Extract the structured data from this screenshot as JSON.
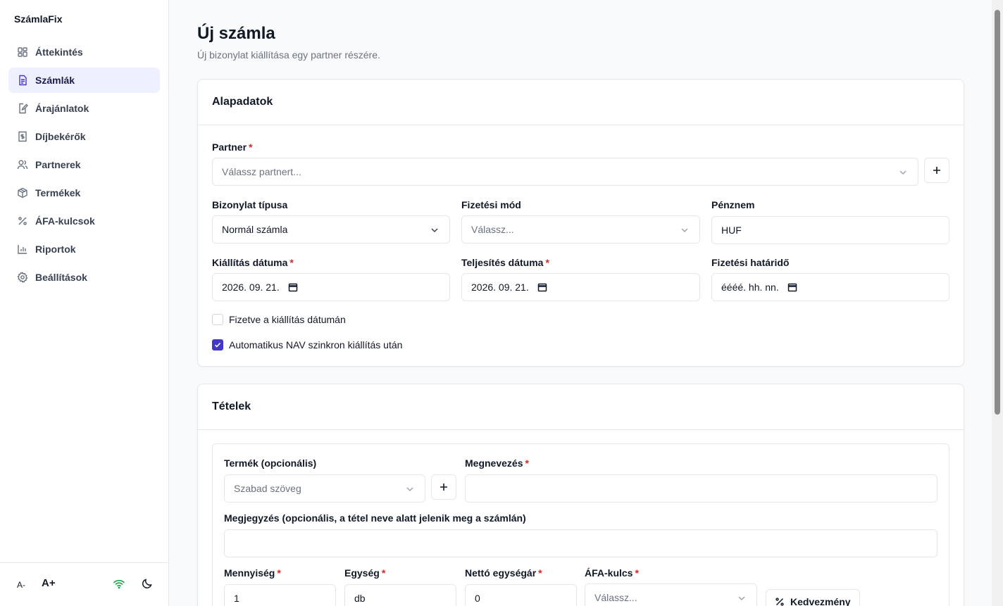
{
  "app": {
    "name": "SzámlaFix"
  },
  "sidebar": {
    "items": [
      {
        "label": "Áttekintés",
        "icon": "dashboard-icon"
      },
      {
        "label": "Számlák",
        "icon": "invoice-icon",
        "active": true
      },
      {
        "label": "Árajánlatok",
        "icon": "quote-icon"
      },
      {
        "label": "Díjbekérők",
        "icon": "payment-request-icon"
      },
      {
        "label": "Partnerek",
        "icon": "users-icon"
      },
      {
        "label": "Termékek",
        "icon": "box-icon"
      },
      {
        "label": "ÁFA-kulcsok",
        "icon": "percent-icon"
      },
      {
        "label": "Riportok",
        "icon": "chart-icon"
      },
      {
        "label": "Beállítások",
        "icon": "gear-icon"
      }
    ],
    "footer": {
      "font_decrease": "A-",
      "font_increase": "A+",
      "online_color": "#16a34a"
    }
  },
  "page": {
    "title": "Új számla",
    "subtitle": "Új bizonylat kiállítása egy partner részére."
  },
  "basics": {
    "title": "Alapadatok",
    "partner_label": "Partner",
    "partner_placeholder": "Válassz partnert...",
    "doc_type_label": "Bizonylat típusa",
    "doc_type_value": "Normál számla",
    "payment_label": "Fizetési mód",
    "payment_placeholder": "Válassz...",
    "currency_label": "Pénznem",
    "currency_value": "HUF",
    "issue_date_label": "Kiállítás dátuma",
    "issue_date_value": "2026. 09. 21.",
    "fulfill_date_label": "Teljesítés dátuma",
    "fulfill_date_value": "2026. 09. 21.",
    "due_date_label": "Fizetési határidő",
    "due_date_placeholder": "éééé. hh. nn.",
    "paid_label": "Fizetve a kiállítás dátumán",
    "paid_checked": false,
    "nav_sync_label": "Automatikus NAV szinkron kiállítás után",
    "nav_sync_checked": true
  },
  "items": {
    "title": "Tételek",
    "product_label": "Termék (opcionális)",
    "product_placeholder": "Szabad szöveg",
    "name_label": "Megnevezés",
    "name_value": "",
    "note_label": "Megjegyzés (opcionális, a tétel neve alatt jelenik meg a számlán)",
    "note_value": "",
    "qty_label": "Mennyiség",
    "qty_value": "1",
    "unit_label": "Egység",
    "unit_value": "db",
    "net_price_label": "Nettó egységár",
    "net_price_value": "0",
    "vat_label": "ÁFA-kulcs",
    "vat_placeholder": "Válassz...",
    "discount_label": "Kedvezmény"
  },
  "required_mark": "*",
  "colors": {
    "accent": "#4338ca",
    "required": "#dc2626",
    "active_bg": "#eef0ff"
  }
}
